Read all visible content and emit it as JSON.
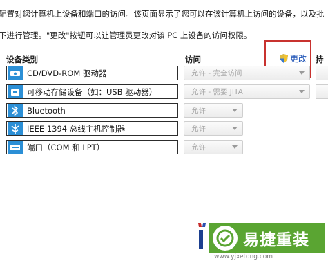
{
  "description": {
    "line1": "配置对您计算机上设备和端口的访问。该页面显示了您可以在该计算机上访问的设备，以及批",
    "line2": "下进行管理。\"更改\"按钮可以让管理员更改对该 PC 上设备的访问权限。"
  },
  "header": {
    "device_type": "设备类别",
    "access": "访问",
    "duration": "持续",
    "change_label": "更改"
  },
  "devices": [
    {
      "label": "CD/DVD-ROM 驱动器",
      "access": "允许 - 完全访问",
      "icon": "disc-icon"
    },
    {
      "label": "可移动存储设备（如：USB 驱动器）",
      "access": "允许 - 需要 JITA",
      "icon": "usb-drive-icon"
    },
    {
      "label": "Bluetooth",
      "access": "允许",
      "icon": "bluetooth-icon"
    },
    {
      "label": "IEEE 1394 总线主机控制器",
      "access": "允许",
      "icon": "firewire-icon"
    },
    {
      "label": "端口（COM 和 LPT）",
      "access": "允许",
      "icon": "port-icon"
    }
  ],
  "watermark": {
    "brand": "易捷重装",
    "url": "www.yjxetong.com"
  },
  "colors": {
    "icon_blue": "#2b8fd6",
    "link_blue": "#1e53b6",
    "highlight_red": "#c8322f",
    "brand_green": "#5aa532"
  }
}
